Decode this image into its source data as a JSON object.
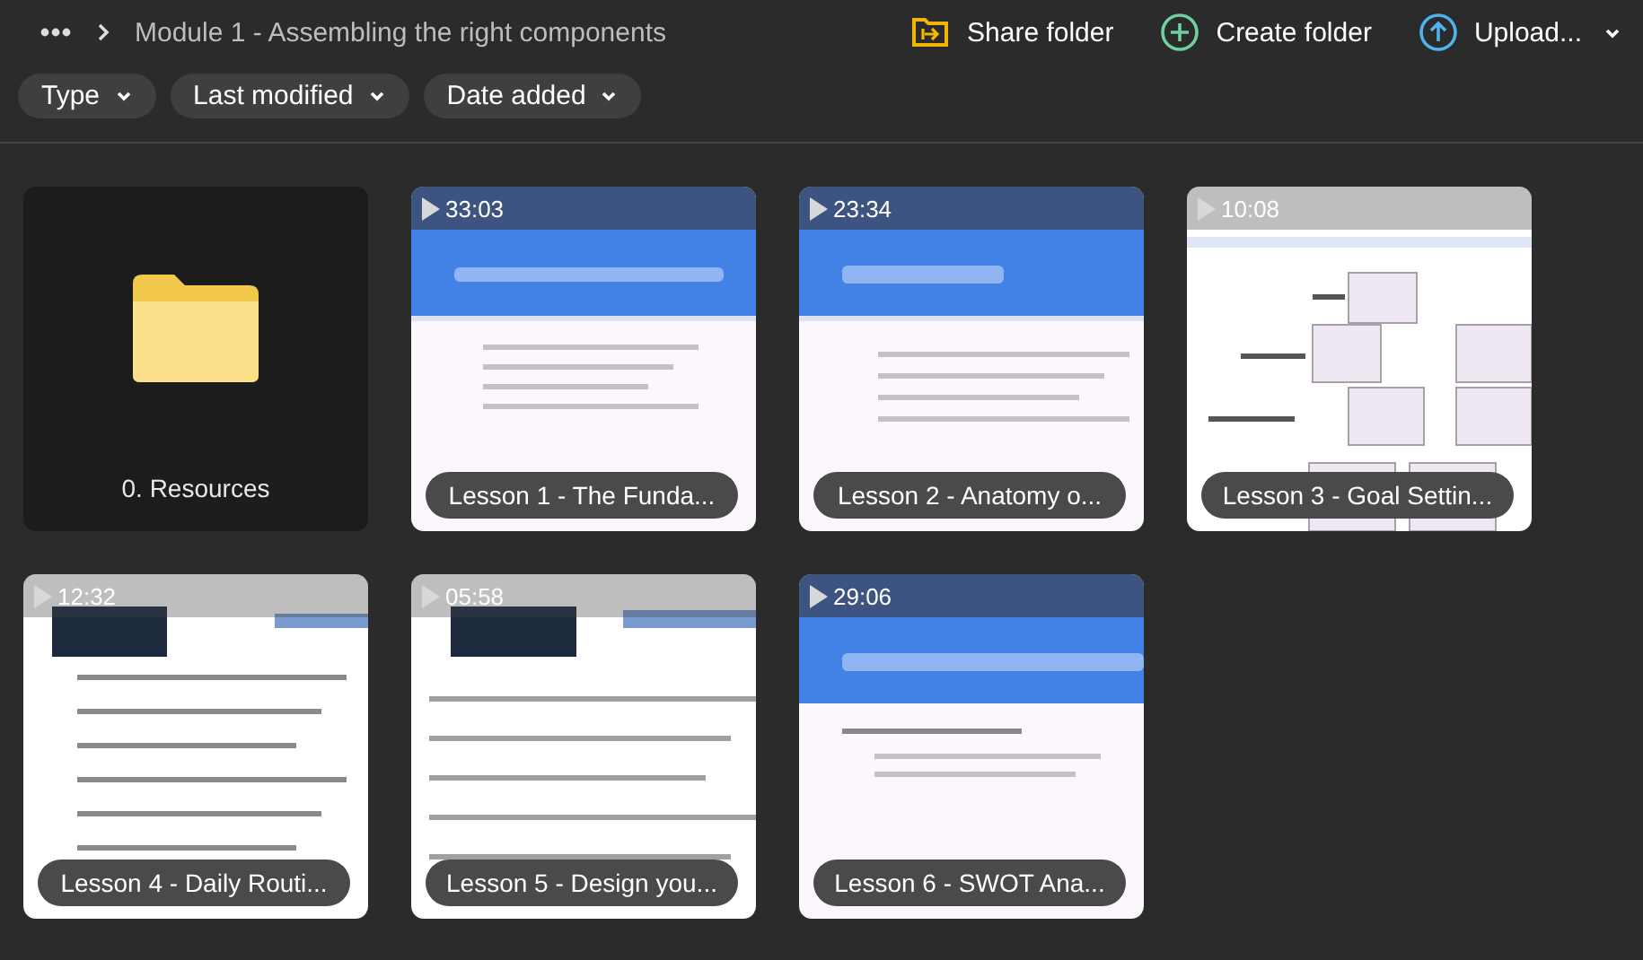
{
  "breadcrumb": {
    "current": "Module 1 - Assembling the right components"
  },
  "actions": [
    {
      "kind": "share",
      "label": "Share folder"
    },
    {
      "kind": "create",
      "label": "Create folder"
    },
    {
      "kind": "upload",
      "label": "Upload..."
    }
  ],
  "filters": [
    {
      "label": "Type"
    },
    {
      "label": "Last modified"
    },
    {
      "label": "Date added"
    }
  ],
  "items": [
    {
      "kind": "folder",
      "name": "0. Resources"
    },
    {
      "kind": "video",
      "duration": "33:03",
      "name": "Lesson 1 - The Funda..."
    },
    {
      "kind": "video",
      "duration": "23:34",
      "name": "Lesson 2 - Anatomy o..."
    },
    {
      "kind": "video",
      "duration": "10:08",
      "name": "Lesson 3 - Goal Settin..."
    },
    {
      "kind": "video",
      "duration": "12:32",
      "name": "Lesson 4 - Daily Routi..."
    },
    {
      "kind": "video",
      "duration": "05:58",
      "name": "Lesson 5 - Design you..."
    },
    {
      "kind": "video",
      "duration": "29:06",
      "name": "Lesson 6 - SWOT Ana..."
    }
  ]
}
